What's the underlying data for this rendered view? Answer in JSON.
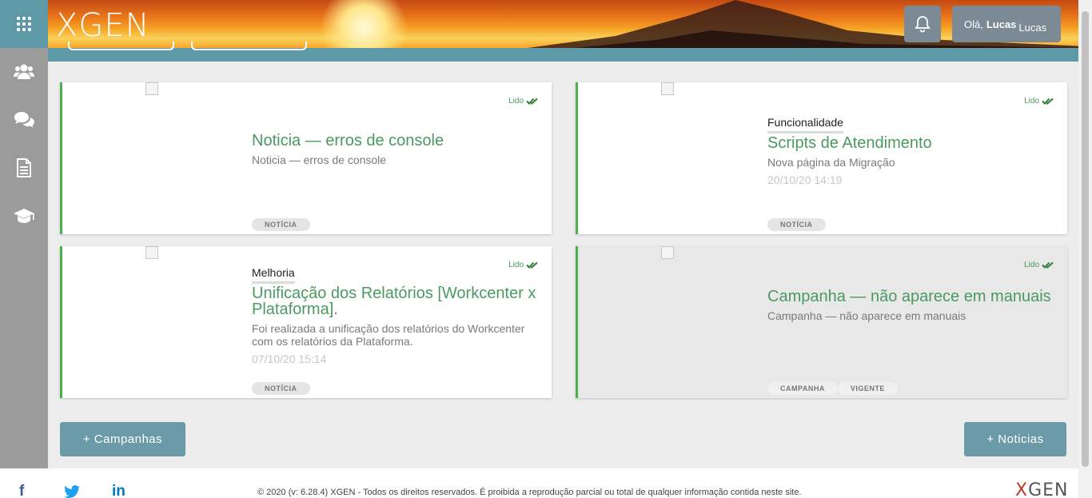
{
  "header": {
    "logo": "XGEN",
    "greeting": "Olá,",
    "user_name": "Lucas",
    "avatar_alt": "Lucas"
  },
  "sidebar": {
    "items": [
      {
        "icon": "users-icon"
      },
      {
        "icon": "chat-icon"
      },
      {
        "icon": "document-icon"
      },
      {
        "icon": "graduation-cap-icon"
      }
    ]
  },
  "cards": [
    {
      "read_label": "Lido",
      "category": "",
      "title": "Noticia — erros de console",
      "description": "Noticia — erros de console",
      "date": "",
      "tags": [
        "NOTÍCIA"
      ]
    },
    {
      "read_label": "Lido",
      "category": "Funcionalidade",
      "title": "Scripts de Atendimento",
      "description": "Nova página da Migração",
      "date": "20/10/20 14:19",
      "tags": [
        "NOTÍCIA"
      ]
    },
    {
      "read_label": "Lido",
      "category": "Melhoria",
      "title": "Unificação dos Relatórios [Workcenter x Plataforma].",
      "description": "Foi realizada a unificação dos relatórios do Workcenter com os relatórios da Plataforma.",
      "date": "07/10/20 15:14",
      "tags": [
        "NOTÍCIA"
      ]
    },
    {
      "read_label": "Lido",
      "category": "",
      "title": "Campanha — não aparece em manuais",
      "description": "Campanha — não aparece em manuais",
      "date": "",
      "tags": [
        "CAMPANHA",
        "VIGENTE"
      ]
    }
  ],
  "buttons": {
    "campanhas": "+ Campanhas",
    "noticias": "+ Noticias"
  },
  "footer": {
    "social": [
      "f",
      "twitter",
      "in"
    ],
    "copyright": "© 2020 (v: 6.28.4) XGEN - Todos os direitos reservados. É proibida a reprodução parcial ou total de qualquer informação contida neste site.",
    "logo": "XGEN"
  },
  "colors": {
    "accent": "#4caf50",
    "teal": "#5e99a8",
    "title_green": "#4a9a60",
    "button": "#6b9ba8"
  }
}
